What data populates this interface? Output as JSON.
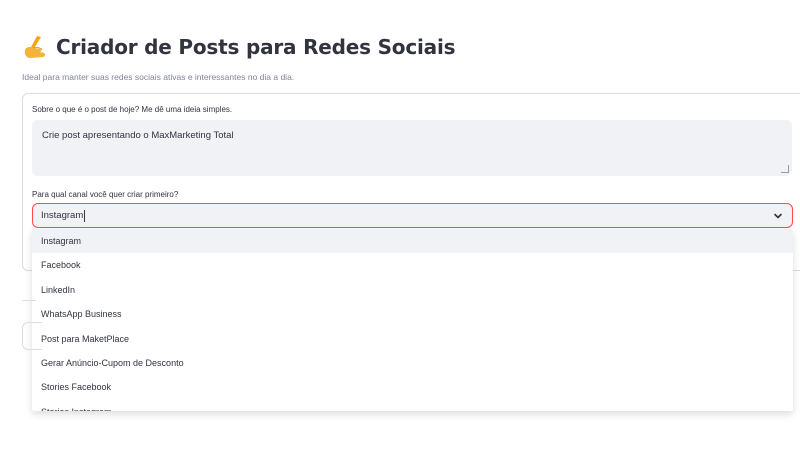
{
  "header": {
    "title": "Criador de Posts para Redes Sociais",
    "subtitle": "Ideal para manter suas redes sociais ativas e interessantes no dia a dia."
  },
  "form": {
    "topic_label": "Sobre o que é o post de hoje? Me dê uma ideia simples.",
    "topic_value": "Crie post apresentando o MaxMarketing Total",
    "channel_label": "Para qual canal você quer criar primeiro?",
    "channel_value": "Instagram",
    "channel_options": [
      "Instagram",
      "Facebook",
      "LinkedIn",
      "WhatsApp Business",
      "Post para MaketPlace",
      "Gerar Anúncio-Cupom de Desconto",
      "Stories Facebook",
      "Stories Instagram"
    ]
  },
  "icons": {
    "title": "writing-hand-icon",
    "select": "chevron-down-icon"
  },
  "colors": {
    "accent": "#ff4b4b",
    "input_bg": "#f0f2f6",
    "text": "#31333f"
  }
}
